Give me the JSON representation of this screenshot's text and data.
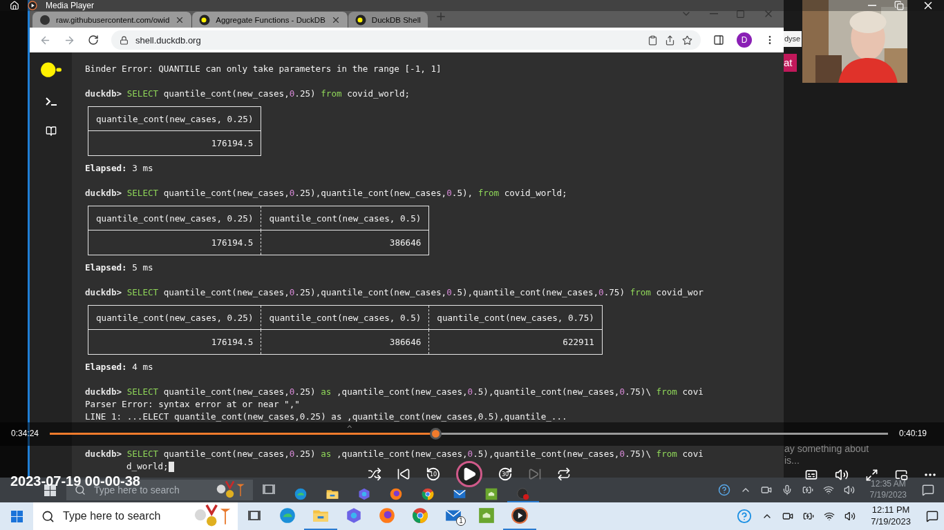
{
  "player": {
    "title": "Media Player",
    "media_title": "2023-07-19 00-00-38",
    "elapsed": "0:34:24",
    "duration": "0:40:19",
    "seek": {
      "level": 0.46
    },
    "playing": false,
    "skip_back_label": "10",
    "skip_forward_label": "30"
  },
  "video": {
    "browser": {
      "tabs": [
        {
          "label": "raw.githubusercontent.com/owid",
          "selected": false
        },
        {
          "label": "Aggregate Functions - DuckDB",
          "selected": false
        },
        {
          "label": "DuckDB Shell",
          "selected": true
        }
      ],
      "url": "shell.duckdb.org",
      "avatar": "D",
      "shell_lines": [
        {
          "kind": "output",
          "text": "Binder Error: QUANTILE can only take parameters in the range [-1, 1]"
        },
        {
          "kind": "command",
          "segments": [
            {
              "kind": "prompt",
              "text": "duckdb>"
            },
            {
              "kind": "keyword",
              "text": " SELECT"
            },
            {
              "kind": "text",
              "text": " quantile_cont(new_cases,"
            },
            {
              "kind": "number",
              "text": "0"
            },
            {
              "kind": "text",
              "text": ".25) "
            },
            {
              "kind": "keyword",
              "text": "from"
            },
            {
              "kind": "text",
              "text": " covid_world;"
            }
          ]
        },
        {
          "kind": "table",
          "columns": [
            "quantile_cont(new_cases, 0.25)"
          ],
          "values": [
            "176194.5"
          ]
        },
        {
          "kind": "elapsed",
          "text": "**Elapsed:** 3 ms"
        },
        {
          "kind": "command",
          "segments": [
            {
              "kind": "prompt",
              "text": "duckdb>"
            },
            {
              "kind": "keyword",
              "text": " SELECT"
            },
            {
              "kind": "text",
              "text": " quantile_cont(new_cases,"
            },
            {
              "kind": "number",
              "text": "0"
            },
            {
              "kind": "text",
              "text": ".25),quantile_cont(new_cases,"
            },
            {
              "kind": "number",
              "text": "0"
            },
            {
              "kind": "text",
              "text": ".5), "
            },
            {
              "kind": "keyword",
              "text": "from"
            },
            {
              "kind": "text",
              "text": " covid_world;"
            }
          ]
        },
        {
          "kind": "table",
          "columns": [
            "quantile_cont(new_cases, 0.25)",
            "quantile_cont(new_cases, 0.5)"
          ],
          "values": [
            "176194.5",
            "386646"
          ]
        },
        {
          "kind": "elapsed",
          "text": "**Elapsed:** 5 ms"
        },
        {
          "kind": "command",
          "segments": [
            {
              "kind": "prompt",
              "text": "duckdb>"
            },
            {
              "kind": "keyword",
              "text": " SELECT"
            },
            {
              "kind": "text",
              "text": " quantile_cont(new_cases,"
            },
            {
              "kind": "number",
              "text": "0"
            },
            {
              "kind": "text",
              "text": ".25),quantile_cont(new_cases,"
            },
            {
              "kind": "number",
              "text": "0"
            },
            {
              "kind": "text",
              "text": ".5),quantile_cont(new_cases,"
            },
            {
              "kind": "number",
              "text": "0"
            },
            {
              "kind": "text",
              "text": ".75) "
            },
            {
              "kind": "keyword",
              "text": "from"
            },
            {
              "kind": "text",
              "text": " covid_wor"
            }
          ]
        },
        {
          "kind": "table",
          "columns": [
            "quantile_cont(new_cases, 0.25)",
            "quantile_cont(new_cases, 0.5)",
            "quantile_cont(new_cases, 0.75)"
          ],
          "values": [
            "176194.5",
            "386646",
            "622911"
          ]
        },
        {
          "kind": "elapsed",
          "text": "**Elapsed:** 4 ms"
        },
        {
          "kind": "command",
          "segments": [
            {
              "kind": "prompt",
              "text": "duckdb>"
            },
            {
              "kind": "keyword",
              "text": " SELECT"
            },
            {
              "kind": "text",
              "text": " quantile_cont(new_cases,"
            },
            {
              "kind": "number",
              "text": "0"
            },
            {
              "kind": "text",
              "text": ".25) "
            },
            {
              "kind": "keyword",
              "text": "as"
            },
            {
              "kind": "text",
              "text": " ,quantile_cont(new_cases,"
            },
            {
              "kind": "number",
              "text": "0"
            },
            {
              "kind": "text",
              "text": ".5),quantile_cont(new_cases,"
            },
            {
              "kind": "number",
              "text": "0"
            },
            {
              "kind": "text",
              "text": ".75)\\ "
            },
            {
              "kind": "keyword",
              "text": "from"
            },
            {
              "kind": "text",
              "text": " covi"
            }
          ]
        },
        {
          "kind": "output",
          "text": "Parser Error: syntax error at or near \",\""
        },
        {
          "kind": "output",
          "text": "LINE 1: ...ELECT quantile_cont(new_cases,0.25) as ,quantile_cont(new_cases,0.5),quantile_..."
        },
        {
          "kind": "output",
          "text": "                                                  ^"
        },
        {
          "kind": "command",
          "segments": [
            {
              "kind": "prompt",
              "text": "duckdb>"
            },
            {
              "kind": "keyword",
              "text": " SELECT"
            },
            {
              "kind": "text",
              "text": " quantile_cont(new_cases,"
            },
            {
              "kind": "number",
              "text": "0"
            },
            {
              "kind": "text",
              "text": ".25) "
            },
            {
              "kind": "keyword",
              "text": "as"
            },
            {
              "kind": "text",
              "text": " ,quantile_cont(new_cases,"
            },
            {
              "kind": "number",
              "text": "0"
            },
            {
              "kind": "text",
              "text": ".5),quantile_cont(new_cases,"
            },
            {
              "kind": "number",
              "text": "0"
            },
            {
              "kind": "text",
              "text": ".75)\\ "
            },
            {
              "kind": "keyword",
              "text": "from"
            },
            {
              "kind": "text",
              "text": " covi"
            }
          ]
        },
        {
          "kind": "input",
          "text": "d_world;"
        }
      ]
    },
    "side_panel": {
      "field_text": "dyse",
      "button": "at",
      "message": "ay something about is..."
    },
    "recorded_taskbar": {
      "search_placeholder": "Type here to search",
      "apps": [
        {
          "kind": "edge",
          "running": false
        },
        {
          "kind": "explorer",
          "running": false
        },
        {
          "kind": "copilot",
          "running": false
        },
        {
          "kind": "firefox",
          "running": false
        },
        {
          "kind": "chrome",
          "running": false
        },
        {
          "kind": "mail",
          "running": false
        },
        {
          "kind": "greenapp",
          "running": false
        },
        {
          "kind": "obs",
          "running": true
        }
      ],
      "time": "12:35 AM",
      "date": "7/19/2023"
    }
  },
  "taskbar": {
    "search_placeholder": "Type here to search",
    "apps": [
      {
        "kind": "edge",
        "running": false
      },
      {
        "kind": "explorer",
        "running": true
      },
      {
        "kind": "copilot",
        "running": false
      },
      {
        "kind": "firefox",
        "running": false
      },
      {
        "kind": "chrome",
        "running": false
      },
      {
        "kind": "mail",
        "running": false,
        "badge": "1"
      },
      {
        "kind": "greenapp",
        "running": false
      },
      {
        "kind": "player",
        "running": true
      }
    ],
    "time": "12:11 PM",
    "date": "7/19/2023"
  }
}
